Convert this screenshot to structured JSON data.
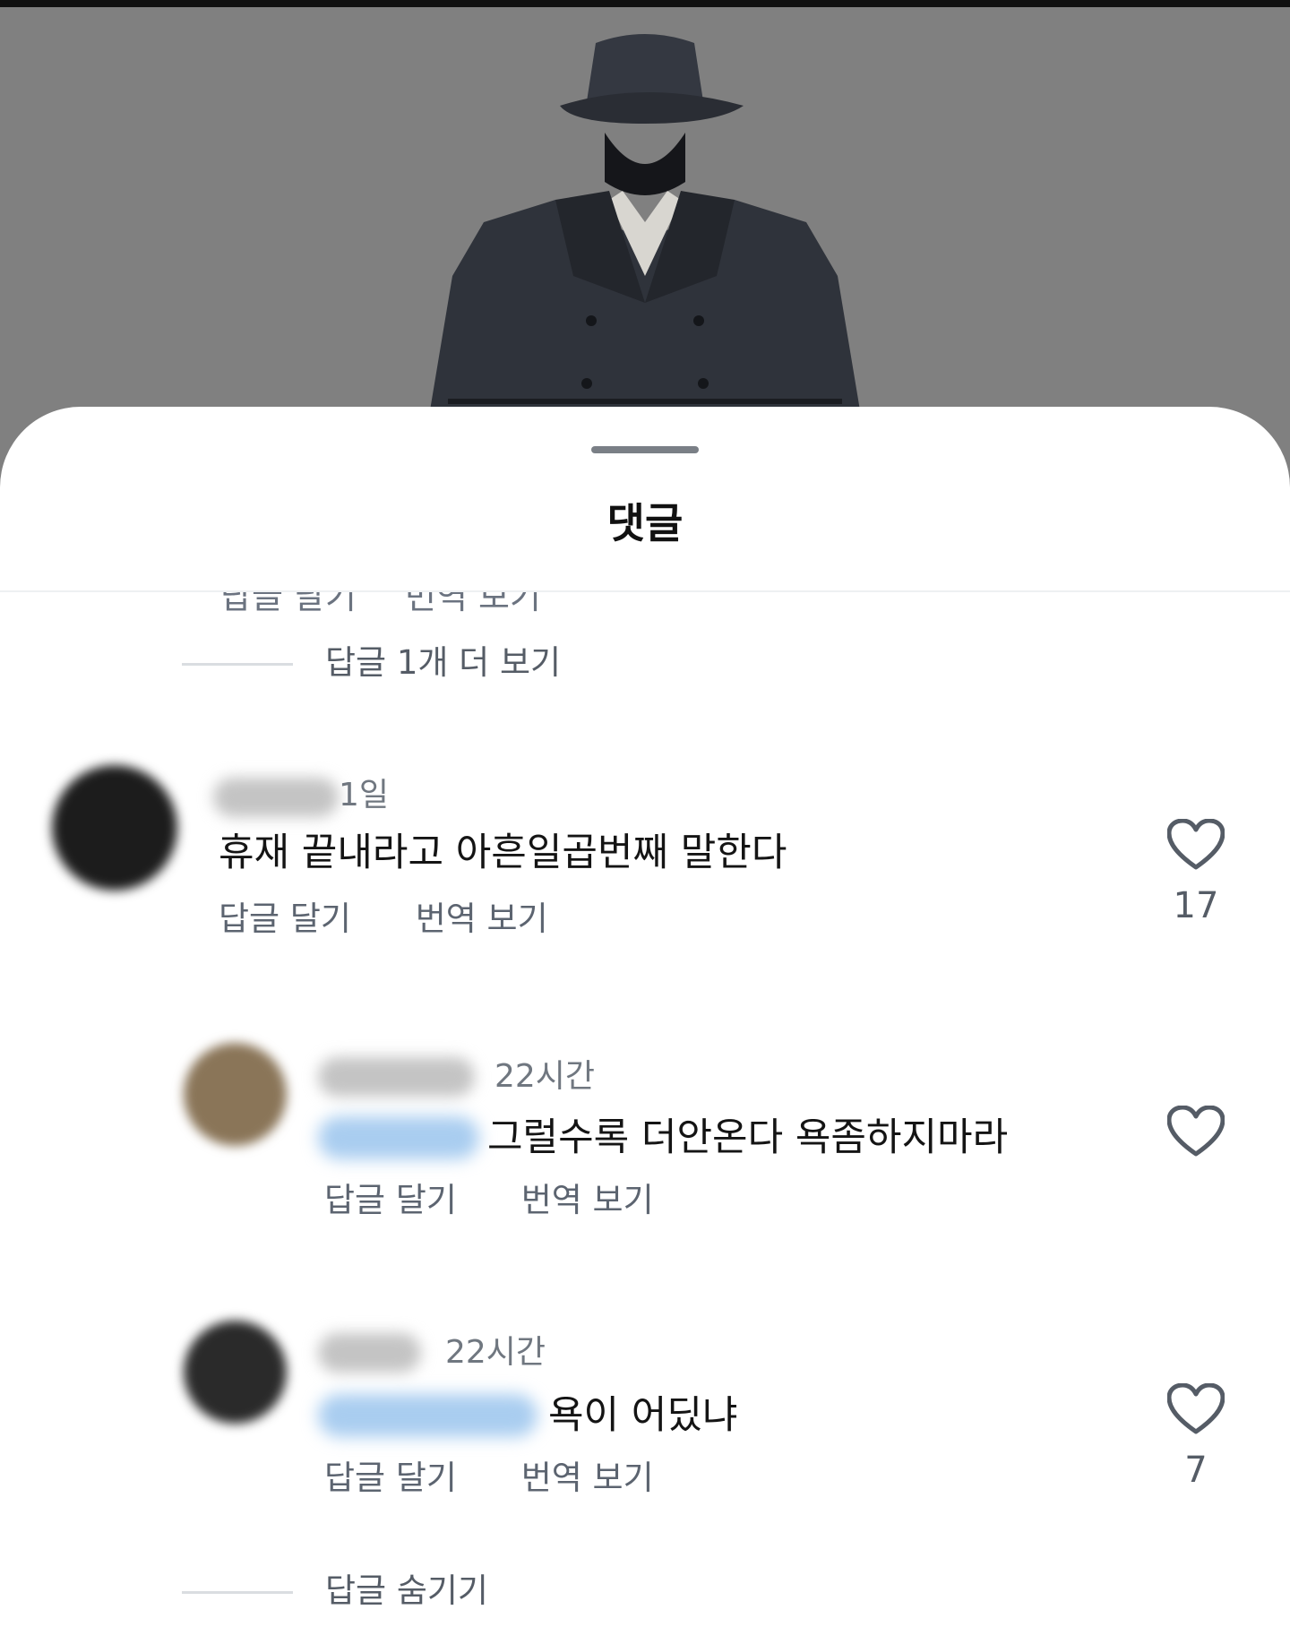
{
  "sheet": {
    "title": "댓글"
  },
  "top_more_replies": {
    "label": "답글 1개 더 보기"
  },
  "clipped_actions": {
    "reply": "답글 달기",
    "translate": "번역 보기"
  },
  "comments": [
    {
      "time": "1일",
      "text": "휴재 끝내라고 아흔일곱번째 말한다",
      "reply_label": "답글 달기",
      "translate_label": "번역 보기",
      "likes": "17"
    },
    {
      "time": "22시간",
      "text": "그럴수록 더안온다 욕좀하지마라",
      "reply_label": "답글 달기",
      "translate_label": "번역 보기",
      "likes": ""
    },
    {
      "time": "22시간",
      "text": "욕이 어딨냐",
      "reply_label": "답글 달기",
      "translate_label": "번역 보기",
      "likes": "7"
    }
  ],
  "bottom_hide_replies": {
    "label": "답글 숨기기"
  },
  "colors": {
    "hero_bg": "#808080",
    "mention": "#a9cdf0",
    "muted_text": "#5c6470"
  },
  "icons": [
    "heart-outline-icon"
  ]
}
